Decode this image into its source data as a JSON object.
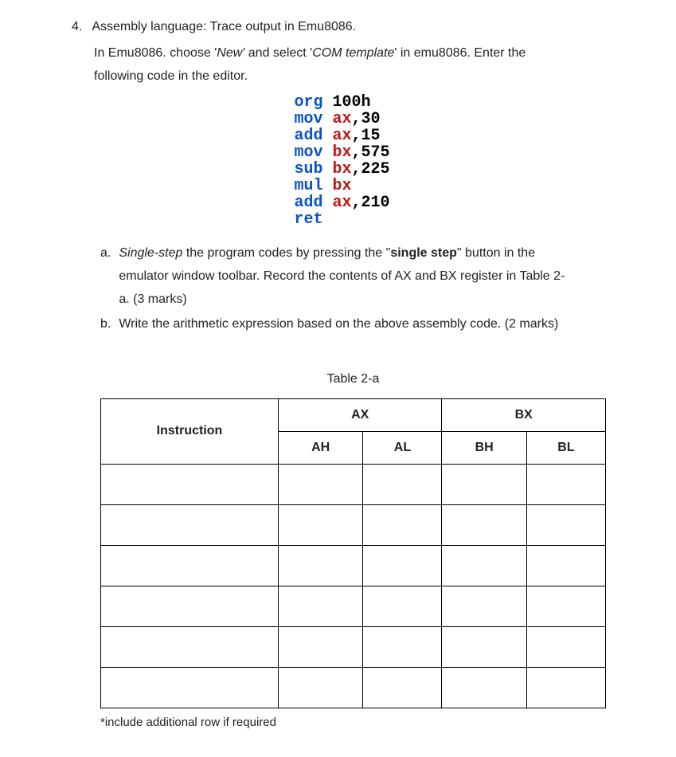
{
  "question": {
    "number": "4.",
    "title": "Assembly language: Trace output in Emu8086.",
    "intro_l1": "In Emu8086. choose 'New' and select 'COM template' in emu8086. Enter the",
    "intro_l2": "following code in the editor."
  },
  "code": {
    "lines": [
      {
        "op": "org",
        "args": " 100h"
      },
      {
        "op": "mov",
        "reg": " ax",
        "rest": ",30"
      },
      {
        "op": "add",
        "reg": " ax",
        "rest": ",15"
      },
      {
        "op": "mov",
        "reg": " bx",
        "rest": ",575"
      },
      {
        "op": "sub",
        "reg": " bx",
        "rest": ",225"
      },
      {
        "op": "mul",
        "reg": " bx",
        "rest": ""
      },
      {
        "op": "add",
        "reg": " ax",
        "rest": ",210"
      },
      {
        "op": "ret",
        "args": ""
      }
    ]
  },
  "subs": {
    "a_letter": "a.",
    "a_l1_pre": "Single-step",
    "a_l1_mid": " the program codes by pressing the \"",
    "a_l1_bold": "single step",
    "a_l1_post": "\" button in the",
    "a_l2": "emulator window toolbar. Record the contents of AX and BX register in Table 2-",
    "a_l3": "a. (3 marks)",
    "b_letter": "b.",
    "b_text": "Write the arithmetic expression based on the above assembly code. (2 marks)"
  },
  "table": {
    "caption": "Table 2-a",
    "headers": {
      "instruction": "Instruction",
      "ax": "AX",
      "bx": "BX",
      "ah": "AH",
      "al": "AL",
      "bh": "BH",
      "bl": "BL"
    },
    "rows": [
      {
        "instr": "",
        "ah": "",
        "al": "",
        "bh": "",
        "bl": ""
      },
      {
        "instr": "",
        "ah": "",
        "al": "",
        "bh": "",
        "bl": ""
      },
      {
        "instr": "",
        "ah": "",
        "al": "",
        "bh": "",
        "bl": ""
      },
      {
        "instr": "",
        "ah": "",
        "al": "",
        "bh": "",
        "bl": ""
      },
      {
        "instr": "",
        "ah": "",
        "al": "",
        "bh": "",
        "bl": ""
      },
      {
        "instr": "",
        "ah": "",
        "al": "",
        "bh": "",
        "bl": ""
      }
    ],
    "footnote": "*include additional row if required"
  }
}
